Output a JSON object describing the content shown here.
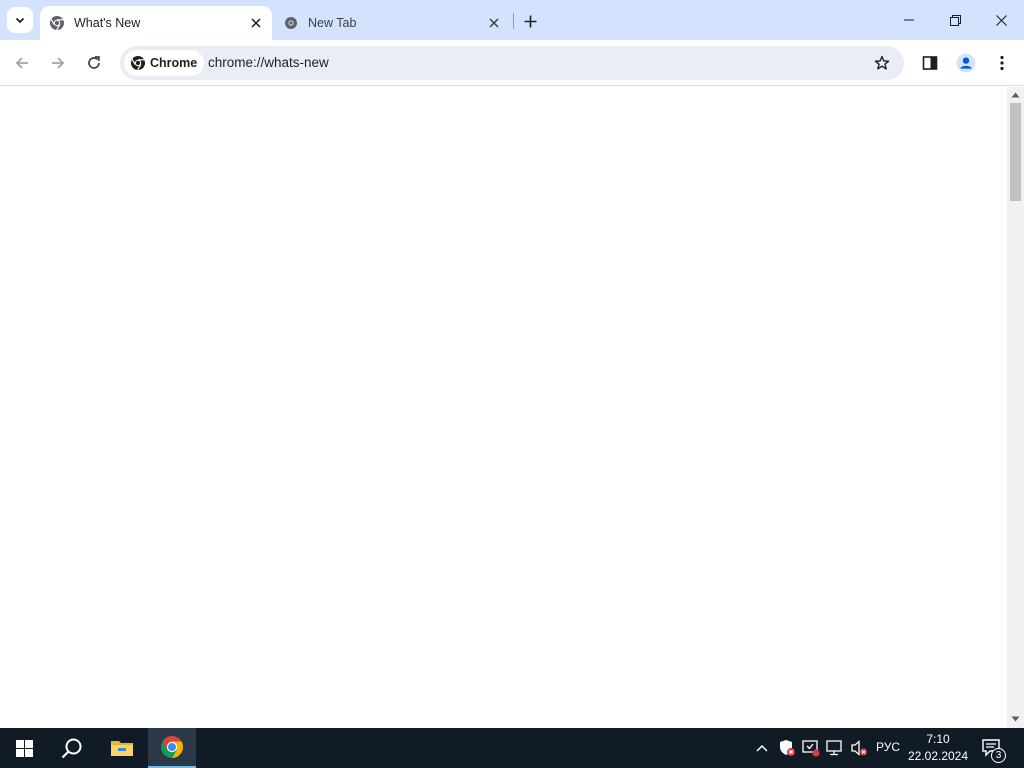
{
  "browser": {
    "tabs": [
      {
        "title": "What's New",
        "active": true,
        "icon": "chrome-icon"
      },
      {
        "title": "New Tab",
        "active": false,
        "icon": "new-tab-icon"
      }
    ],
    "toolbar": {
      "site_chip": "Chrome",
      "url": "chrome://whats-new"
    },
    "colors": {
      "tabstrip_bg": "#d3e3fd",
      "omnibox_bg": "#e9eef6",
      "taskbar_bg": "#101b26"
    }
  },
  "taskbar": {
    "language": "РУС",
    "time": "7:10",
    "date": "22.02.2024",
    "notification_count": "3",
    "pinned": [
      "windows-start-icon",
      "search-icon",
      "file-explorer-icon",
      "chrome-icon"
    ]
  }
}
